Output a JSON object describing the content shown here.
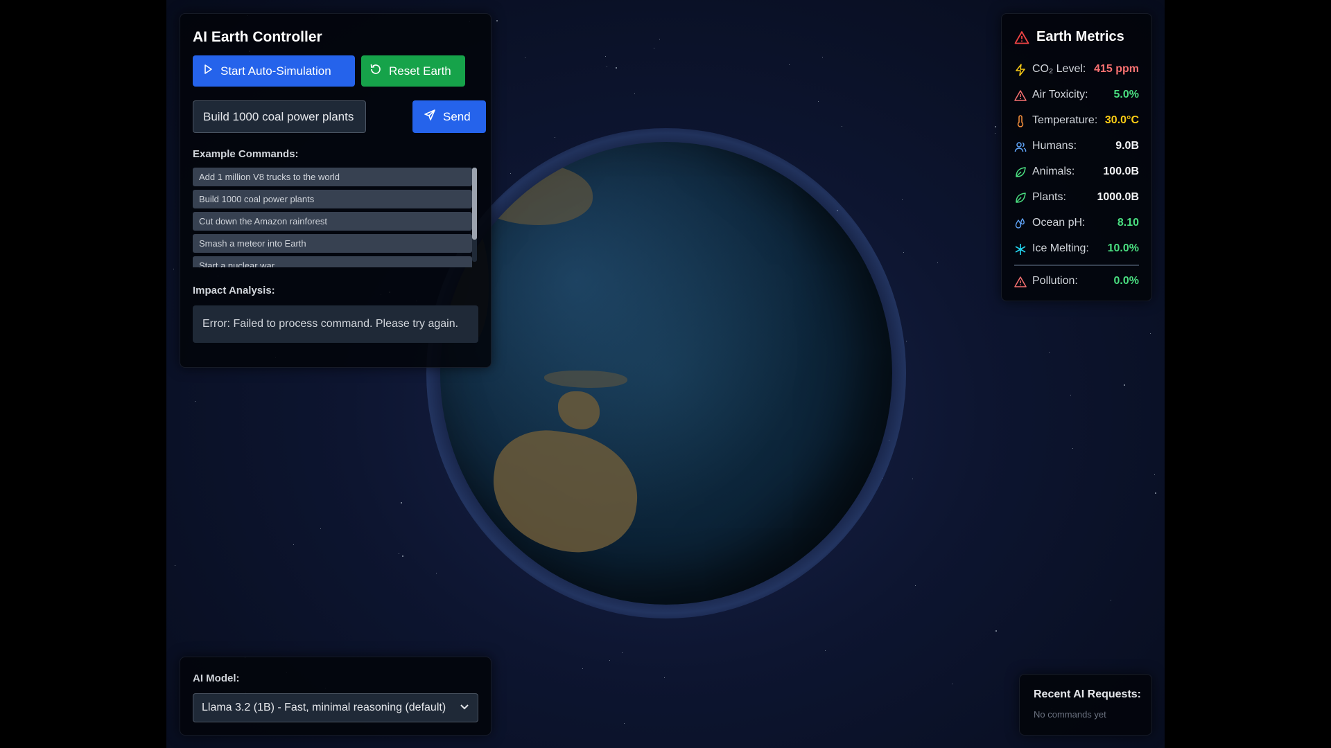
{
  "controller": {
    "title": "AI Earth Controller",
    "auto_sim_label": "Start Auto-Simulation",
    "reset_label": "Reset Earth",
    "command_value": "Build 1000 coal power plants",
    "send_label": "Send",
    "examples_label": "Example Commands:",
    "examples": [
      "Add 1 million V8 trucks to the world",
      "Build 1000 coal power plants",
      "Cut down the Amazon rainforest",
      "Smash a meteor into Earth",
      "Start a nuclear war"
    ],
    "impact_label": "Impact Analysis:",
    "impact_text": "Error: Failed to process command. Please try again."
  },
  "metrics": {
    "title": "Earth Metrics",
    "rows": [
      {
        "icon": "lightning-icon",
        "label": "CO₂ Level:",
        "value": "415 ppm",
        "color": "#f87171"
      },
      {
        "icon": "warning-icon",
        "label": "Air Toxicity:",
        "value": "5.0%",
        "color": "#4ade80"
      },
      {
        "icon": "thermometer-icon",
        "label": "Temperature:",
        "value": "30.0°C",
        "color": "#facc15"
      },
      {
        "icon": "users-icon",
        "label": "Humans:",
        "value": "9.0B",
        "color": "#f3f4f6"
      },
      {
        "icon": "leaf-icon",
        "label": "Animals:",
        "value": "100.0B",
        "color": "#f3f4f6"
      },
      {
        "icon": "leaf-icon",
        "label": "Plants:",
        "value": "1000.0B",
        "color": "#f3f4f6"
      },
      {
        "icon": "droplet-icon",
        "label": "Ocean pH:",
        "value": "8.10",
        "color": "#4ade80"
      },
      {
        "icon": "snowflake-icon",
        "label": "Ice Melting:",
        "value": "10.0%",
        "color": "#4ade80"
      },
      {
        "icon": "warning-icon",
        "label": "Pollution:",
        "value": "0.0%",
        "color": "#4ade80"
      }
    ]
  },
  "model": {
    "label": "AI Model:",
    "selected": "Llama 3.2 (1B) - Fast, minimal reasoning (default)"
  },
  "recent": {
    "title": "Recent AI Requests:",
    "empty_text": "No commands yet"
  }
}
